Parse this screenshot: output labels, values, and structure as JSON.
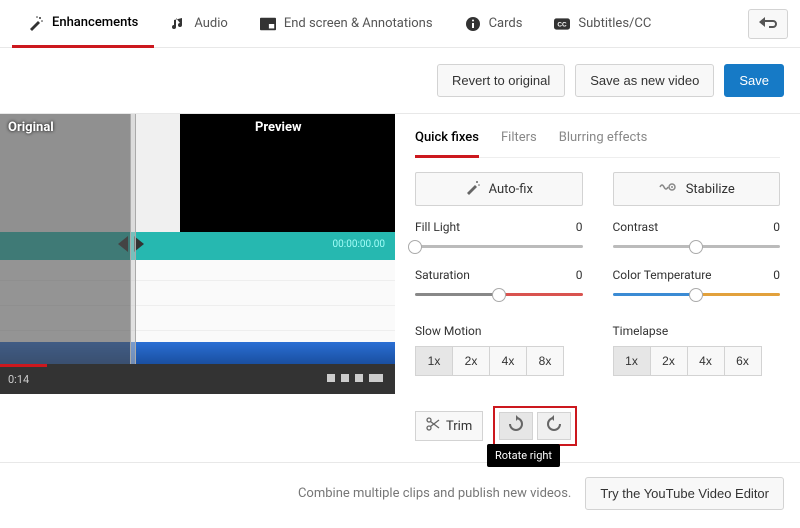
{
  "top_tabs": {
    "enhancements": "Enhancements",
    "audio": "Audio",
    "endscreen": "End screen & Annotations",
    "cards": "Cards",
    "subtitles": "Subtitles/CC"
  },
  "actions": {
    "revert": "Revert to original",
    "save_new": "Save as new video",
    "save": "Save"
  },
  "preview": {
    "original_label": "Original",
    "preview_label": "Preview",
    "timeline_time": "00:00:00.00",
    "current_time": "0:14"
  },
  "sub_tabs": {
    "quick_fixes": "Quick fixes",
    "filters": "Filters",
    "blurring": "Blurring effects"
  },
  "quick": {
    "auto_fix": "Auto-fix",
    "stabilize": "Stabilize",
    "fill_light": {
      "label": "Fill Light",
      "value": "0"
    },
    "contrast": {
      "label": "Contrast",
      "value": "0"
    },
    "saturation": {
      "label": "Saturation",
      "value": "0"
    },
    "color_temp": {
      "label": "Color Temperature",
      "value": "0"
    },
    "slow_motion": {
      "label": "Slow Motion",
      "options": [
        "1x",
        "2x",
        "4x",
        "8x"
      ]
    },
    "timelapse": {
      "label": "Timelapse",
      "options": [
        "1x",
        "2x",
        "4x",
        "6x"
      ]
    },
    "trim": "Trim",
    "tooltip_rotate_right": "Rotate right"
  },
  "bottom": {
    "text": "Combine multiple clips and publish new videos.",
    "cta": "Try the YouTube Video Editor"
  }
}
